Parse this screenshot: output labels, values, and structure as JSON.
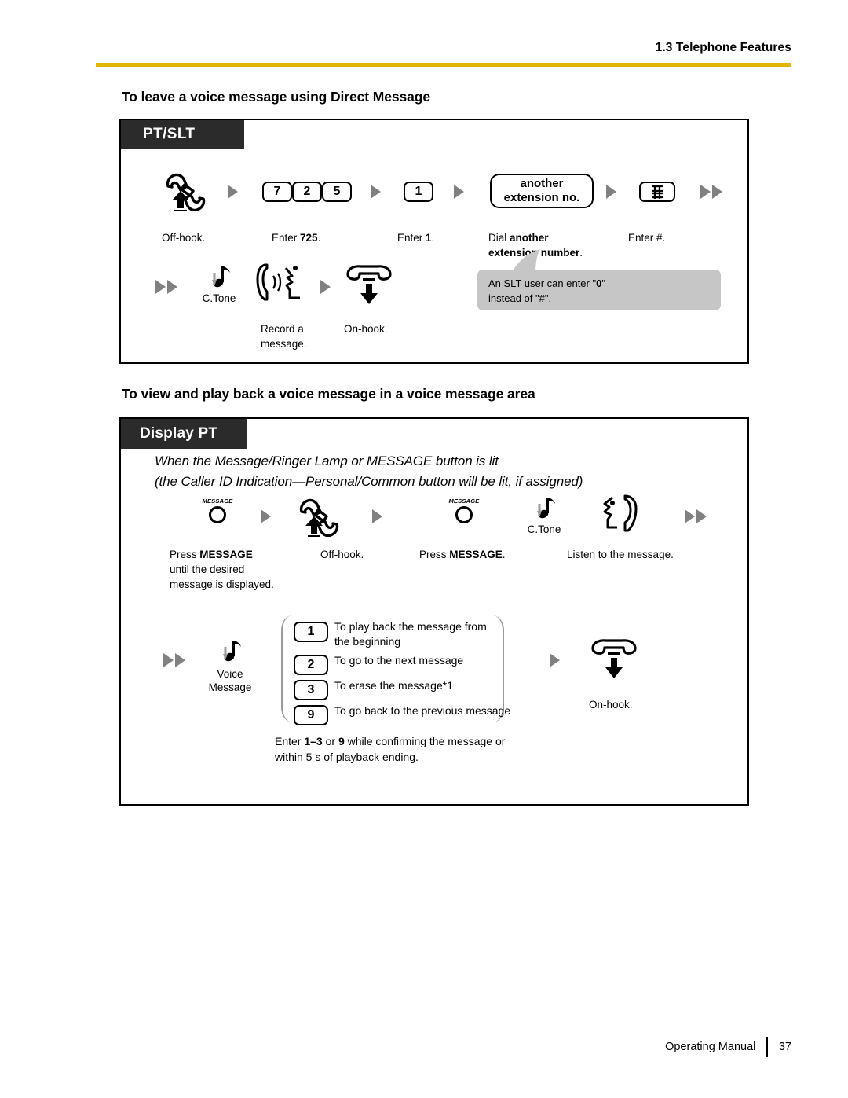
{
  "header": {
    "section_label": "1.3 Telephone Features",
    "rule_color": "#e0b60d"
  },
  "footer": {
    "manual_label": "Operating Manual",
    "page_number": "37"
  },
  "sections": [
    {
      "heading": "To leave a voice message using Direct Message",
      "tag": "PT/SLT",
      "steps_row1": [
        {
          "icon": "offhook-handset-icon",
          "caption": "Off-hook."
        },
        {
          "icon": "keys-725",
          "keys": [
            "7",
            "2",
            "5"
          ],
          "caption_pre": "Enter ",
          "caption_bold": "725",
          "caption_post": "."
        },
        {
          "icon": "key-1",
          "keys": [
            "1"
          ],
          "caption_pre": "Enter ",
          "caption_bold": "1",
          "caption_post": "."
        },
        {
          "icon": "another-extension-box",
          "line1": "another",
          "line2": "extension no.",
          "caption_pre": "Dial ",
          "caption_bold": "another\nextension number",
          "caption_post": "."
        },
        {
          "icon": "hash-key-icon",
          "caption": "Enter #."
        }
      ],
      "steps_row2": [
        {
          "icon": "confirmation-tone-icon",
          "label": "C.Tone"
        },
        {
          "icon": "record-message-icon",
          "caption": "Record a\nmessage."
        },
        {
          "icon": "onhook-handset-icon",
          "caption": "On-hook."
        }
      ],
      "callout": {
        "line1_pre": "An SLT user can enter \"",
        "line1_bold": "0",
        "line1_post": "\"",
        "line2": "instead of \"#\"."
      }
    },
    {
      "heading": "To view and play back a voice message in a voice message area",
      "tag": "Display PT",
      "intro_line_1": "When the Message/Ringer Lamp or MESSAGE button is lit",
      "intro_line_2": "(the Caller ID Indication—Personal/Common button will be lit, if assigned)",
      "steps_row1": [
        {
          "icon": "message-button-icon",
          "icon_label": "MESSAGE",
          "caption_pre": "Press ",
          "caption_bold": "MESSAGE",
          "caption_post": "\nuntil the desired\nmessage is displayed."
        },
        {
          "icon": "offhook-handset-icon",
          "caption": "Off-hook."
        },
        {
          "icon": "message-button-icon",
          "icon_label": "MESSAGE",
          "caption_pre": "Press ",
          "caption_bold": "MESSAGE",
          "caption_post": "."
        },
        {
          "icon": "confirmation-tone-icon",
          "label": "C.Tone"
        },
        {
          "icon": "listen-message-icon",
          "caption": "Listen to the message."
        }
      ],
      "steps_row2": {
        "voice_message_label": "Voice\nMessage",
        "options": [
          {
            "key": "1",
            "text": "To play back the message from\nthe beginning"
          },
          {
            "key": "2",
            "text": "To go to the next message"
          },
          {
            "key": "3",
            "text": "To erase the message*1"
          },
          {
            "key": "9",
            "text": "To go back to the previous message"
          }
        ],
        "note_pre": "Enter ",
        "note_bold_1": "1–3",
        "note_mid": " or ",
        "note_bold_2": "9",
        "note_post": " while confirming the message or\nwithin 5 s of playback ending.",
        "onhook_caption": "On-hook."
      }
    }
  ]
}
